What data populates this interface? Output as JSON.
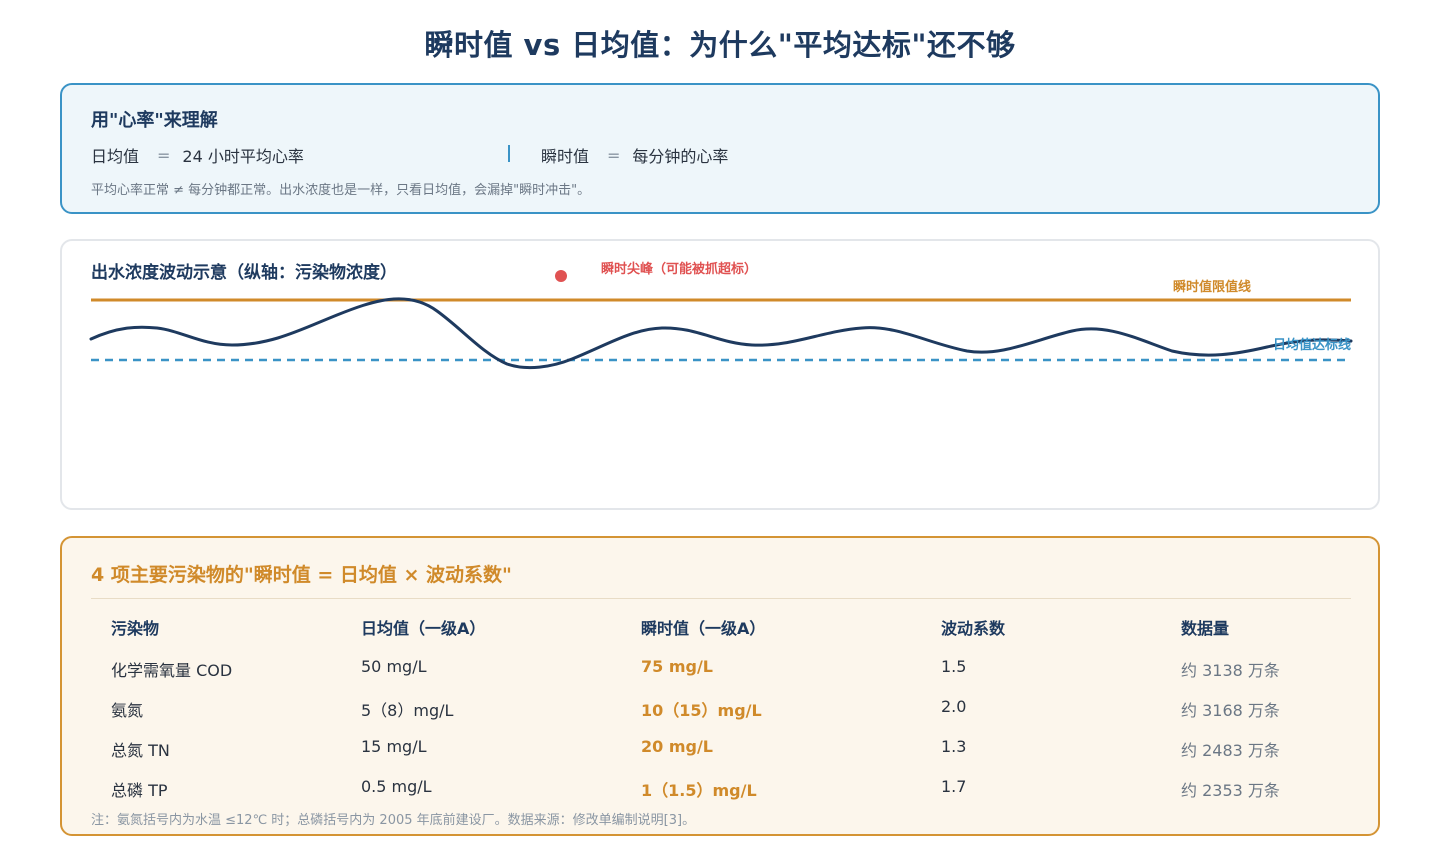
{
  "page": {
    "title": "瞬时值 vs 日均值：为什么\"平均达标\"还不够"
  },
  "analogy": {
    "title": "用\"心率\"来理解",
    "left_term": "日均值",
    "left_def": "24 小时平均心率",
    "right_term": "瞬时值",
    "right_def": "每分钟的心率",
    "equals": "=",
    "note": "平均心率正常 ≠ 每分钟都正常。出水浓度也是一样，只看日均值，会漏掉\"瞬时冲击\"。"
  },
  "chart": {
    "title": "出水浓度波动示意（纵轴：污染物浓度）",
    "spike_label": "瞬时尖峰（可能被抓超标）",
    "instant_limit_label": "瞬时值限值线",
    "daily_limit_label": "日均值达标线",
    "colors": {
      "wave": "#1e3a5f",
      "instant_limit": "#d08a2a",
      "daily_limit": "#3a93c6",
      "spike": "#e05252"
    }
  },
  "table": {
    "title": "4 项主要污染物的\"瞬时值 = 日均值 × 波动系数\"",
    "headers": [
      "污染物",
      "日均值（一级A）",
      "瞬时值（一级A）",
      "波动系数",
      "数据量"
    ],
    "rows": [
      [
        "化学需氧量 COD",
        "50 mg/L",
        "75 mg/L",
        "1.5",
        "约 3138 万条"
      ],
      [
        "氨氮",
        "5（8）mg/L",
        "10（15）mg/L",
        "2.0",
        "约 3168 万条"
      ],
      [
        "总氮 TN",
        "15 mg/L",
        "20 mg/L",
        "1.3",
        "约 2483 万条"
      ],
      [
        "总磷 TP",
        "0.5 mg/L",
        "1（1.5）mg/L",
        "1.7",
        "约 2353 万条"
      ]
    ],
    "note": "注：氨氮括号内为水温 ≤12℃ 时；总磷括号内为 2005 年底前建设厂。数据来源：修改单编制说明[3]。"
  }
}
